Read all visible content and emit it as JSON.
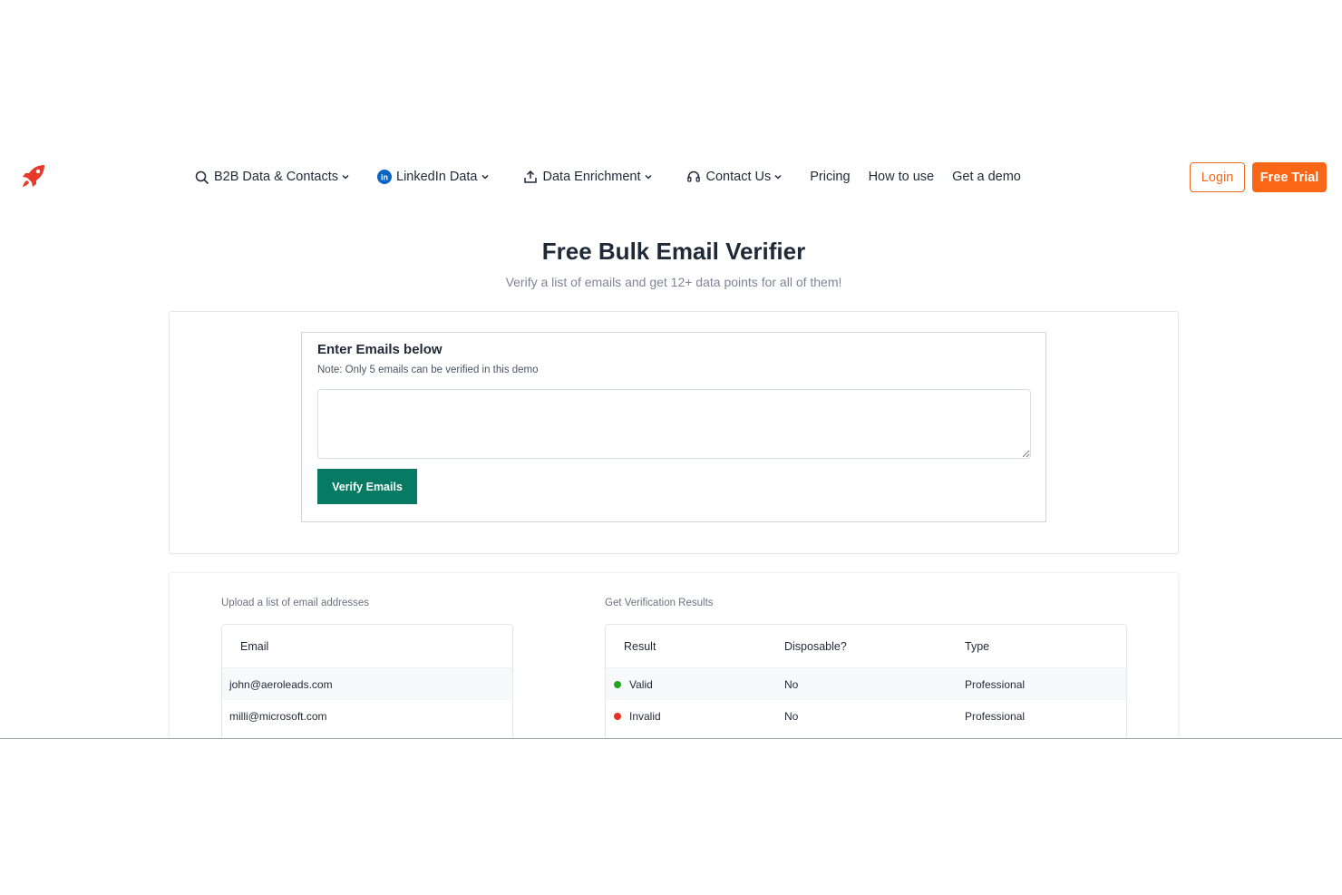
{
  "header": {
    "logo_icon": "rocket-icon",
    "nav": [
      {
        "label": "B2B Data & Contacts",
        "icon": "search-icon",
        "dropdown": true
      },
      {
        "label": "LinkedIn Data",
        "icon": "linkedin-icon",
        "dropdown": true
      },
      {
        "label": "Data Enrichment",
        "icon": "upload-icon",
        "dropdown": true
      },
      {
        "label": "Contact Us",
        "icon": "headset-icon",
        "dropdown": true
      },
      {
        "label": "Pricing",
        "dropdown": false
      },
      {
        "label": "How to use",
        "dropdown": false
      },
      {
        "label": "Get a demo",
        "dropdown": false
      }
    ],
    "login_label": "Login",
    "trial_label": "Free Trial"
  },
  "hero": {
    "title": "Free Bulk Email Verifier",
    "subtitle": "Verify a list of emails and get 12+ data points for all of them!"
  },
  "verifier": {
    "title": "Enter Emails below",
    "note": "Note: Only 5 emails can be verified in this demo",
    "input_value": "",
    "button_label": "Verify Emails"
  },
  "results": {
    "upload_label": "Upload a list of email addresses",
    "results_label": "Get Verification Results",
    "email_header": "Email",
    "columns": [
      "Result",
      "Disposable?",
      "Type"
    ],
    "rows": [
      {
        "email": "john@aeroleads.com",
        "result": "Valid",
        "status_color": "#22a622",
        "disposable": "No",
        "type": "Professional"
      },
      {
        "email": "milli@microsoft.com",
        "result": "Invalid",
        "status_color": "#e5341d",
        "disposable": "No",
        "type": "Professional"
      }
    ]
  },
  "colors": {
    "accent_orange": "#f96716",
    "verify_green": "#067a63",
    "rocket_red": "#e8392b",
    "linkedin_blue": "#0a66c2"
  }
}
